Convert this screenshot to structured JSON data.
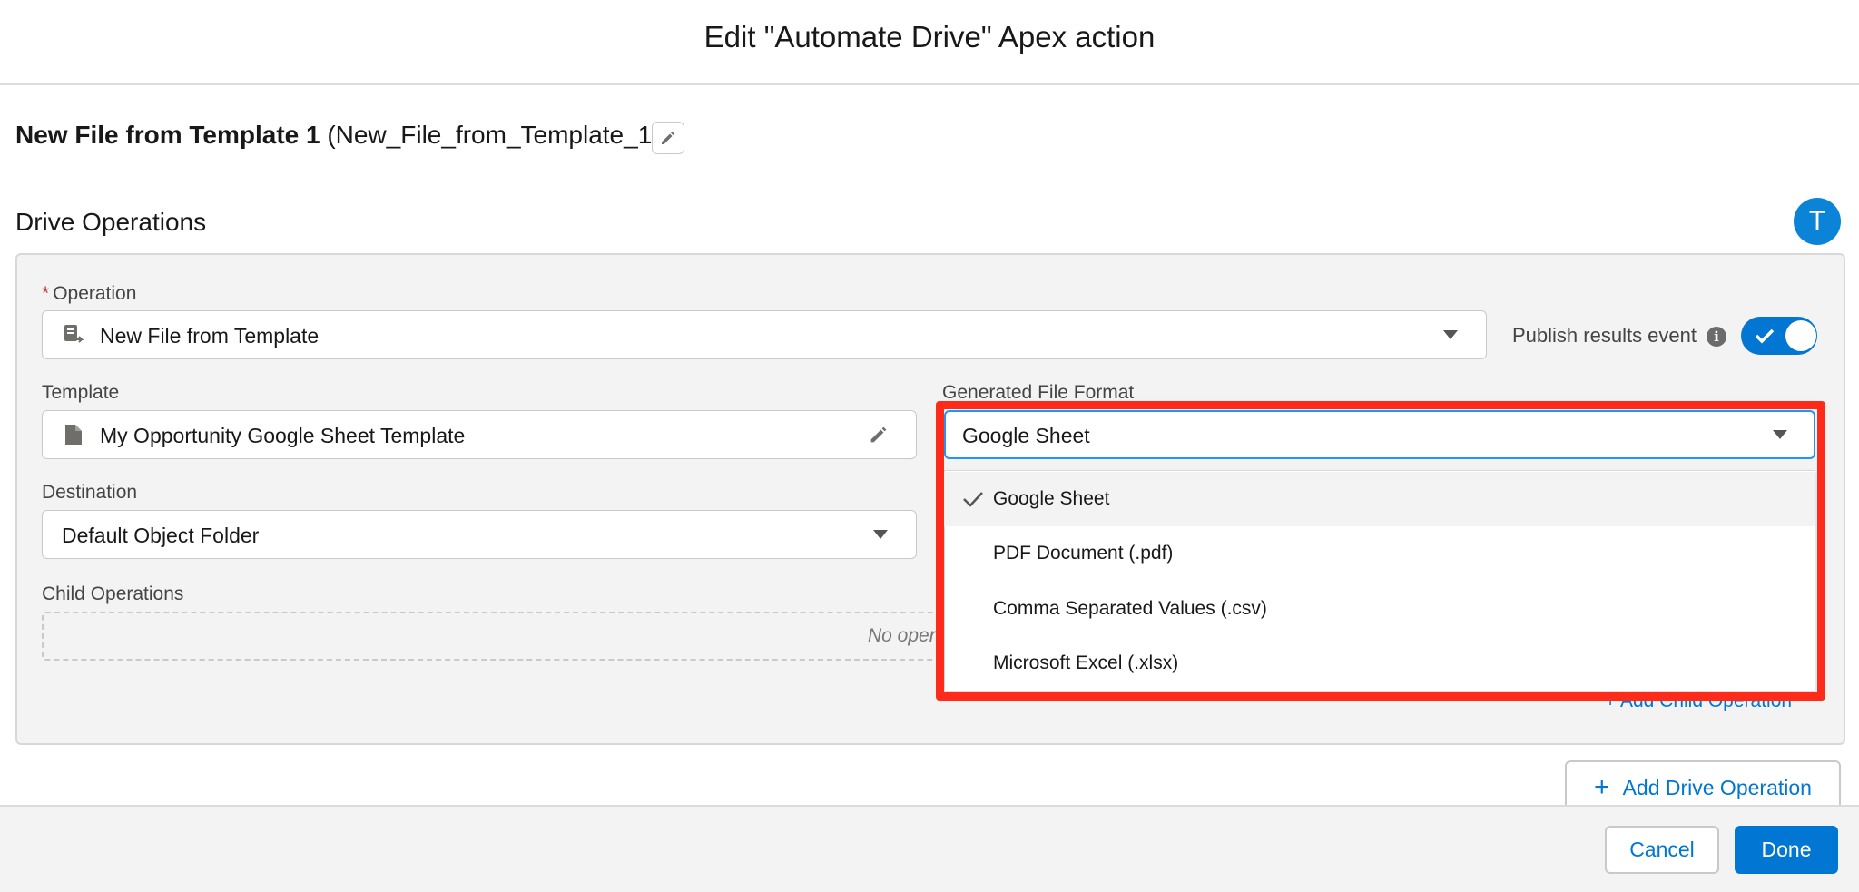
{
  "modal": {
    "title": "Edit \"Automate Drive\" Apex action"
  },
  "action": {
    "name": "New File from Template 1",
    "api_name": "(New_File_from_Template_1)"
  },
  "section": {
    "title": "Drive Operations",
    "avatar_letter": "T"
  },
  "operation": {
    "label": "Operation",
    "required_mark": "*",
    "value": "New File from Template"
  },
  "publish": {
    "label": "Publish results event",
    "info_glyph": "i",
    "enabled": true
  },
  "template": {
    "label": "Template",
    "value": "My Opportunity Google Sheet Template"
  },
  "format": {
    "label": "Generated File Format",
    "value": "Google Sheet",
    "options": [
      "Google Sheet",
      "PDF Document (.pdf)",
      "Comma Separated Values (.csv)",
      "Microsoft Excel (.xlsx)"
    ],
    "selected_index": 0
  },
  "destination": {
    "label": "Destination",
    "value": "Default Object Folder"
  },
  "child_ops": {
    "label": "Child Operations",
    "empty_text": "No oper",
    "add_label": "Add Child Operation"
  },
  "add_drive_label": "Add Drive Operation",
  "footer": {
    "cancel_label": "Cancel",
    "done_label": "Done"
  },
  "colors": {
    "accent": "#0176d3",
    "highlight": "#ff2b1a",
    "avatar": "#0b84d8"
  }
}
